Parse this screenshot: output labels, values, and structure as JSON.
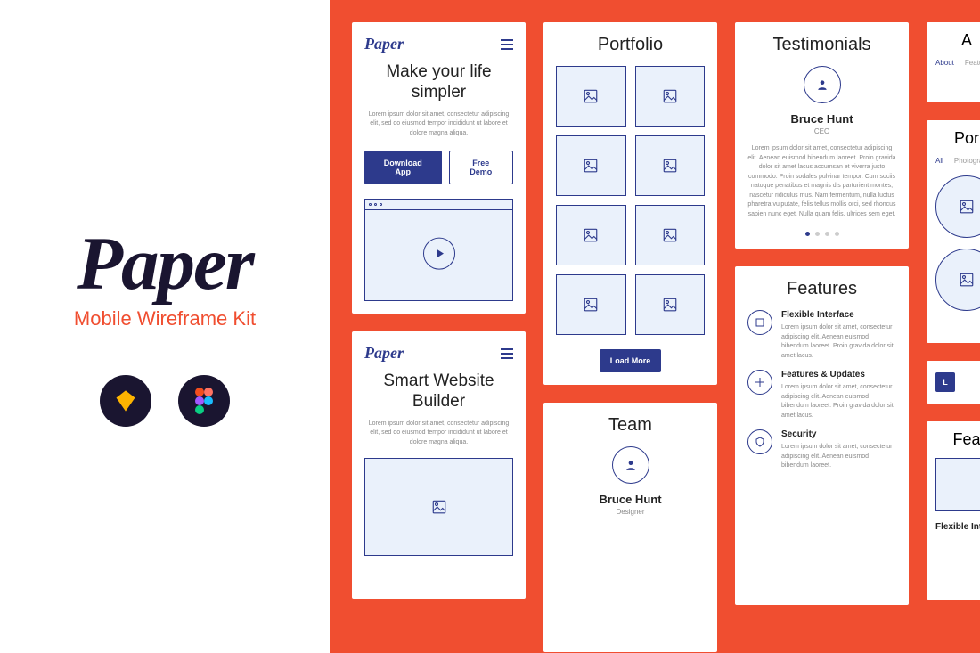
{
  "left": {
    "logo": "Paper",
    "subtitle": "Mobile Wireframe Kit"
  },
  "screen1": {
    "logo": "Paper",
    "title": "Make your life simpler",
    "lorem": "Lorem ipsum dolor sit amet, consectetur adipiscing elit, sed do eiusmod tempor incididunt ut labore et dolore magna aliqua.",
    "download": "Download App",
    "demo": "Free Demo"
  },
  "screen2": {
    "logo": "Paper",
    "title": "Smart Website Builder",
    "lorem": "Lorem ipsum dolor sit amet, consectetur adipiscing elit, sed do eiusmod tempor incididunt ut labore et dolore magna aliqua."
  },
  "portfolio": {
    "title": "Portfolio",
    "load_more": "Load More"
  },
  "team": {
    "title": "Team",
    "name": "Bruce Hunt",
    "role": "Designer"
  },
  "testimonials": {
    "title": "Testimonials",
    "name": "Bruce Hunt",
    "role": "CEO",
    "lorem": "Lorem ipsum dolor sit amet, consectetur adipiscing elit. Aenean euismod bibendum laoreet. Proin gravida dolor sit amet lacus accumsan et viverra justo commodo. Proin sodales pulvinar tempor. Cum sociis natoque penatibus et magnis dis parturient montes, nascetur ridiculus mus. Nam fermentum, nulla luctus pharetra vulputate, felis tellus mollis orci, sed rhoncus sapien nunc eget. Nulla quam felis, ultrices sem eget."
  },
  "features": {
    "title": "Features",
    "items": [
      {
        "title": "Flexible Interface",
        "lorem": "Lorem ipsum dolor sit amet, consectetur adipiscing elit. Aenean euismod bibendum laoreet. Proin gravida dolor sit amet lacus."
      },
      {
        "title": "Features & Updates",
        "lorem": "Lorem ipsum dolor sit amet, consectetur adipiscing elit. Aenean euismod bibendum laoreet. Proin gravida dolor sit amet lacus."
      },
      {
        "title": "Security",
        "lorem": "Lorem ipsum dolor sit amet, consectetur adipiscing elit. Aenean euismod bibendum laoreet."
      }
    ]
  },
  "partial": {
    "a": "A",
    "tab1": "About",
    "tab2": "Features",
    "por": "Por",
    "filter_all": "All",
    "filter_photo": "Photography",
    "load": "L",
    "fea": "Fea",
    "flex": "Flexible Inter"
  }
}
